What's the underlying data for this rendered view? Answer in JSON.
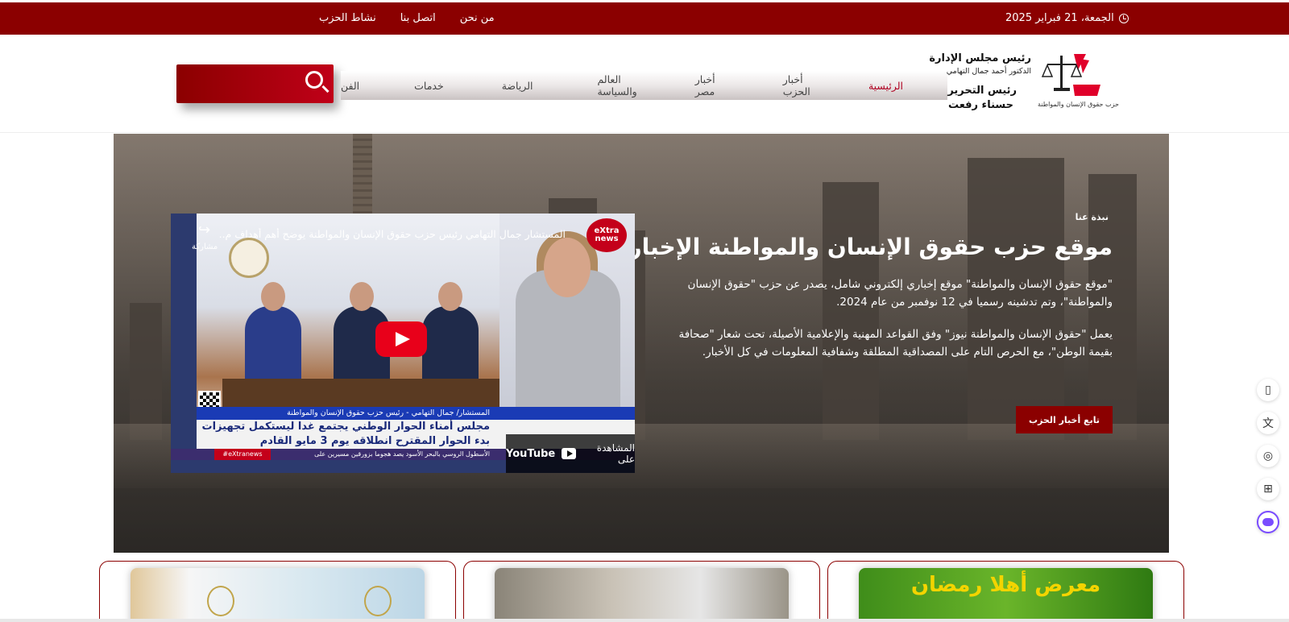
{
  "topbar": {
    "links": [
      "من نحن",
      "اتصل بنا",
      "نشاط الحزب"
    ],
    "date": "الجمعة، 21 فبراير 2025"
  },
  "header": {
    "nav": [
      "الرئيسية",
      "أخبار الحزب",
      "أخبار مصر",
      "العالم والسياسة",
      "الرياضة",
      "خدمات",
      "الفن"
    ],
    "chair_title": "رئيس مجلس الإدارة",
    "chair_name": "الدكتور أحمد جمال التهامي",
    "editor_title": "رئيس التحرير",
    "editor_name": "حسناء رفعت",
    "party_name": "حزب حقوق الإنسان والمواطنة"
  },
  "hero": {
    "tag": "نبذة عنا",
    "title": "موقع حزب حقوق الإنسان والمواطنة الإخباري",
    "p1": "\"موقع حقوق الإنسان والمواطنة\" موقع إخباري إلكتروني شامل، يصدر عن حزب \"حقوق الإنسان والمواطنة\"، وتم تدشينه رسميا في 12 نوفمبر من عام 2024.",
    "p2": "يعمل \"حقوق الإنسان والمواطنة نيوز\" وفق القواعد المهنية والإعلامية الأصيلة، تحت شعار \"صحافة بقيمة الوطن\"، مع الحرص التام على المصداقية المطلقة وشفافية المعلومات في كل الأخبار.",
    "follow_button": "تابع أخبار الحزب"
  },
  "video": {
    "title": "المستشار جمال التهامي رئيس حزب حقوق الإنسان والمواطنة يوضح أهم أهداف م...",
    "share_label": "مشاركة",
    "channel": "eXtra news",
    "lower_strip": "المستشار/ جمال التهامي - رئيس حزب حقوق الإنسان والمواطنة",
    "headline": "مجلس أمناء الحوار الوطني يجتمع غدا ليستكمل تجهيزات بدء الحوار المقترح انطلاقه يوم 3 مايو القادم",
    "ticker": "الأسطول الروسي بالبحر الأسود يصد هجوما بزورقين مسيرين على",
    "hashtag": "#eXtranews",
    "watch_on": "المشاهدة على",
    "youtube": "YouTube"
  },
  "side_tools": [
    "book-icon",
    "translate-icon",
    "podcast-icon",
    "apps-icon",
    "assistant-icon"
  ],
  "cards": [
    "card-1",
    "card-2",
    "card-3"
  ],
  "card3_banner": "معرض أهلا رمضان",
  "colors": {
    "brand": "#8b0000",
    "accent": "#c00018"
  }
}
